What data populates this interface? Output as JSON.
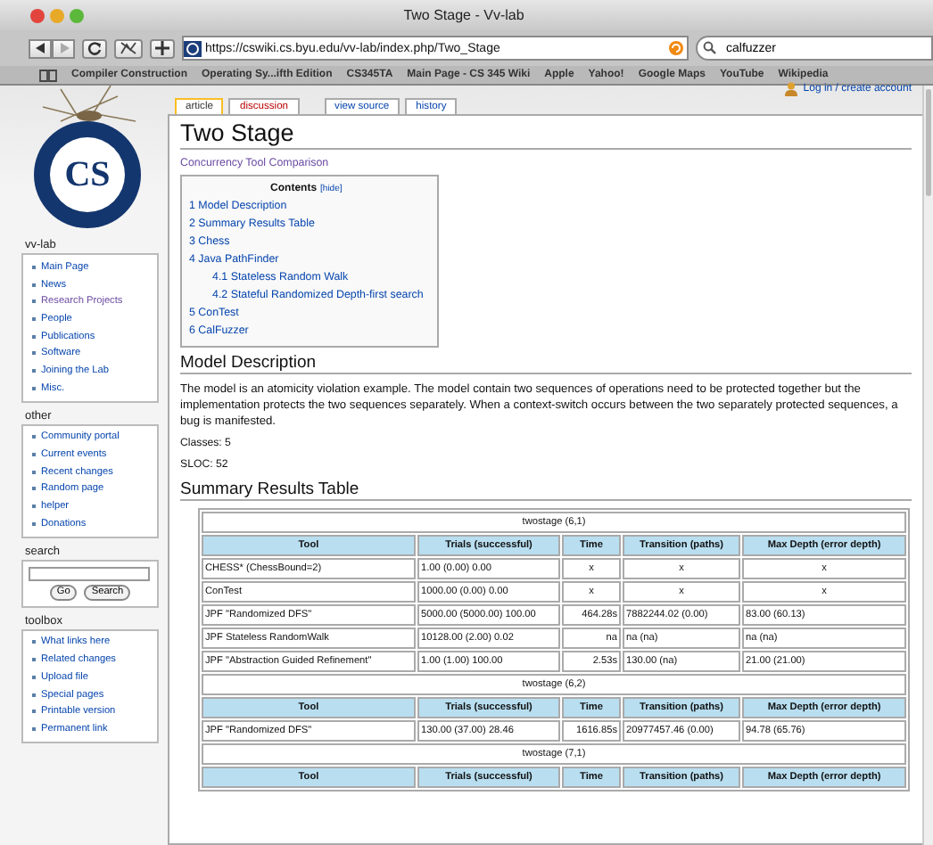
{
  "window": {
    "title": "Two Stage - Vv-lab"
  },
  "toolbar": {
    "url": "https://cswiki.cs.byu.edu/vv-lab/index.php/Two_Stage",
    "search": "calfuzzer"
  },
  "bookmarks": [
    "Compiler Construction",
    "Operating Sy...ifth Edition",
    "CS345TA",
    "Main Page - CS 345 Wiki",
    "Apple",
    "Yahoo!",
    "Google Maps",
    "YouTube",
    "Wikipedia"
  ],
  "login": "Log in / create account",
  "logo": {
    "initials": "CS"
  },
  "sidebar": [
    {
      "title": "vv-lab",
      "items": [
        {
          "label": "Main Page",
          "visited": false
        },
        {
          "label": "News",
          "visited": false
        },
        {
          "label": "Research Projects",
          "visited": true
        },
        {
          "label": "People",
          "visited": false
        },
        {
          "label": "Publications",
          "visited": false
        },
        {
          "label": "Software",
          "visited": false
        },
        {
          "label": "Joining the Lab",
          "visited": false
        },
        {
          "label": "Misc.",
          "visited": false
        }
      ]
    },
    {
      "title": "other",
      "items": [
        {
          "label": "Community portal",
          "visited": false
        },
        {
          "label": "Current events",
          "visited": false
        },
        {
          "label": "Recent changes",
          "visited": false
        },
        {
          "label": "Random page",
          "visited": false
        },
        {
          "label": "helper",
          "visited": false
        },
        {
          "label": "Donations",
          "visited": false
        }
      ]
    }
  ],
  "search": {
    "title": "search",
    "buttons": [
      "Go",
      "Search"
    ]
  },
  "toolbox": {
    "title": "toolbox",
    "items": [
      "What links here",
      "Related changes",
      "Upload file",
      "Special pages",
      "Printable version",
      "Permanent link"
    ]
  },
  "page_tabs": [
    {
      "label": "article",
      "selected": true,
      "missing": false
    },
    {
      "label": "discussion",
      "selected": false,
      "missing": true
    }
  ],
  "action_tabs": [
    {
      "label": "view source",
      "selected": false
    },
    {
      "label": "history",
      "selected": false
    }
  ],
  "heading": "Two Stage",
  "category_link": {
    "label": "Concurrency Tool Comparison",
    "visited": true
  },
  "toc": {
    "title": "Contents",
    "toggle": "[hide]",
    "items": [
      {
        "label": "1 Model Description"
      },
      {
        "label": "2 Summary Results Table"
      },
      {
        "label": "3 Chess"
      },
      {
        "label": "4 Java PathFinder",
        "children": [
          {
            "label": "4.1 Stateless Random Walk"
          },
          {
            "label": "4.2 Stateful Randomized Depth-first search"
          }
        ]
      },
      {
        "label": "5 ConTest"
      },
      {
        "label": "6 CalFuzzer"
      }
    ]
  },
  "model_heading": "Model Description",
  "description": "The model is an atomicity violation example. The model contain two sequences of operations need to be protected together but the implementation protects the two sequences separately. When a context-switch occurs between the two separately protected sequences, a bug is manifested.",
  "facts": [
    "Classes: 5",
    "SLOC: 52"
  ],
  "summary_heading": "Summary Results Table",
  "table": {
    "sections": [
      {
        "title": "twostage (6,1)",
        "columns": [
          "Tool",
          "Trials (successful)",
          "Time",
          "Transition (paths)",
          "Max Depth (error depth)"
        ],
        "rows": [
          [
            {
              "text": "CHESS* (ChessBound=2)",
              "kind": "value"
            },
            {
              "text": "1.00 (0.00) 0.00",
              "kind": "value"
            },
            {
              "text": "x",
              "kind": "mark"
            },
            {
              "text": "x",
              "kind": "mark"
            },
            {
              "text": "x",
              "kind": "mark"
            }
          ],
          [
            {
              "text": "ConTest",
              "kind": "value"
            },
            {
              "text": "1000.00 (0.00) 0.00",
              "kind": "value"
            },
            {
              "text": "x",
              "kind": "mark"
            },
            {
              "text": "x",
              "kind": "mark"
            },
            {
              "text": "x",
              "kind": "mark"
            }
          ],
          [
            {
              "text": "JPF \"Randomized DFS\"",
              "kind": "value"
            },
            {
              "text": "5000.00 (5000.00) 100.00",
              "kind": "value"
            },
            {
              "text": "464.28s",
              "kind": "value"
            },
            {
              "text": "7882244.02 (0.00)",
              "kind": "value"
            },
            {
              "text": "83.00 (60.13)",
              "kind": "value"
            }
          ],
          [
            {
              "text": "JPF Stateless RandomWalk",
              "kind": "value"
            },
            {
              "text": "10128.00 (2.00) 0.02",
              "kind": "value"
            },
            {
              "text": "na",
              "kind": "value"
            },
            {
              "text": "na (na)",
              "kind": "value"
            },
            {
              "text": "na (na)",
              "kind": "value"
            }
          ],
          [
            {
              "text": "JPF \"Abstraction Guided Refinement\"",
              "kind": "value"
            },
            {
              "text": "1.00 (1.00) 100.00",
              "kind": "value"
            },
            {
              "text": "2.53s",
              "kind": "value"
            },
            {
              "text": "130.00 (na)",
              "kind": "value"
            },
            {
              "text": "21.00 (21.00)",
              "kind": "value"
            }
          ]
        ]
      },
      {
        "title": "twostage (6,2)",
        "columns": [
          "Tool",
          "Trials (successful)",
          "Time",
          "Transition (paths)",
          "Max Depth (error depth)"
        ],
        "rows": [
          [
            {
              "text": "JPF \"Randomized DFS\"",
              "kind": "value"
            },
            {
              "text": "130.00 (37.00) 28.46",
              "kind": "value"
            },
            {
              "text": "1616.85s",
              "kind": "value"
            },
            {
              "text": "20977457.46 (0.00)",
              "kind": "value"
            },
            {
              "text": "94.78 (65.76)",
              "kind": "value"
            }
          ]
        ]
      },
      {
        "title": "twostage (7,1)",
        "columns": [
          "Tool",
          "Trials (successful)",
          "Time",
          "Transition (paths)",
          "Max Depth (error depth)"
        ]
      }
    ]
  }
}
